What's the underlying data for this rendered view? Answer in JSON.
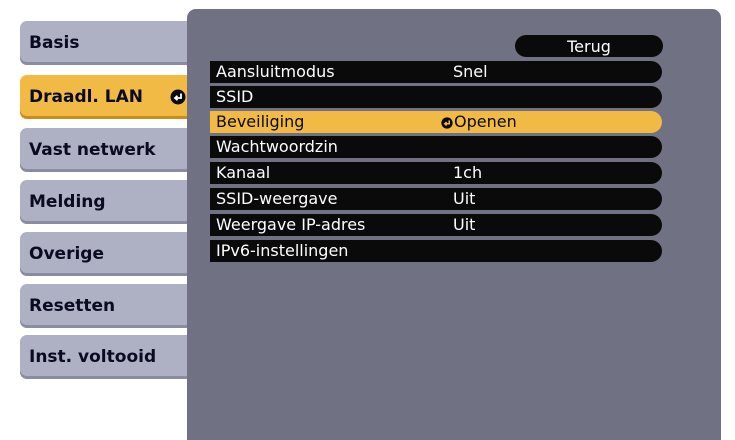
{
  "sidebar": {
    "items": [
      {
        "label": "Basis"
      },
      {
        "label": "Draadl. LAN"
      },
      {
        "label": "Vast netwerk"
      },
      {
        "label": "Melding"
      },
      {
        "label": "Overige"
      },
      {
        "label": "Resetten"
      },
      {
        "label": "Inst. voltooid"
      }
    ],
    "active_index": 1
  },
  "panel": {
    "back_label": "Terug",
    "rows": [
      {
        "label": "Aansluitmodus",
        "value": "Snel"
      },
      {
        "label": "SSID",
        "value": ""
      },
      {
        "label": "Beveiliging",
        "value": "Openen"
      },
      {
        "label": "Wachtwoordzin",
        "value": ""
      },
      {
        "label": "Kanaal",
        "value": "1ch"
      },
      {
        "label": "SSID-weergave",
        "value": "Uit"
      },
      {
        "label": "Weergave IP-adres",
        "value": "Uit"
      },
      {
        "label": "IPv6-instellingen",
        "value": ""
      }
    ],
    "highlight_index": 2
  },
  "colors": {
    "accent": "#f1ba45",
    "tab": "#aeb1c3",
    "panel": "#707284",
    "row": "#0a0a0a"
  },
  "icons": [
    "enter-icon"
  ]
}
